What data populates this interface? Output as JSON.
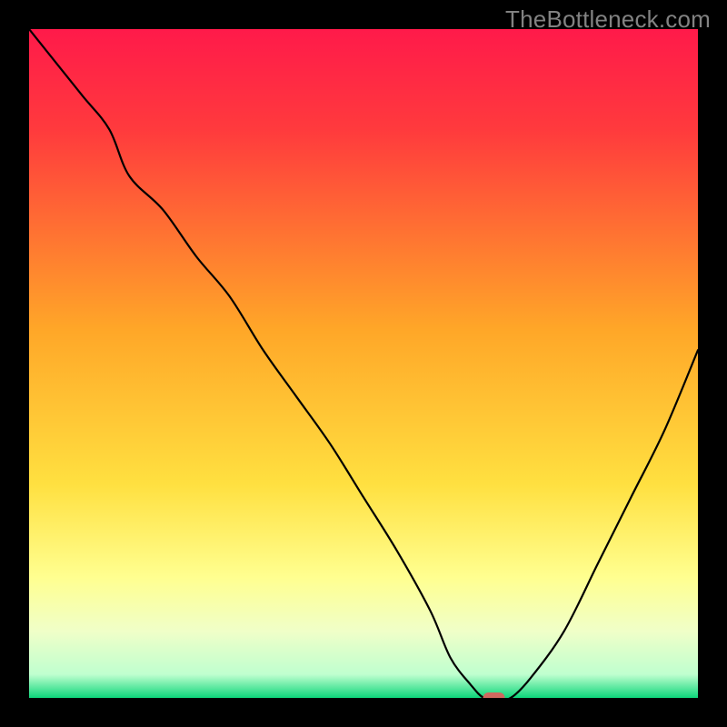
{
  "attribution": "TheBottleneck.com",
  "colors": {
    "gradient_top": "#ff1a4a",
    "gradient_mid": "#ffc300",
    "gradient_lowmid": "#ffff80",
    "gradient_pale": "#f5ffd8",
    "gradient_bottom": "#0dd67a",
    "curve": "#000000",
    "marker": "#cf695f",
    "frame": "#000000"
  },
  "chart_data": {
    "type": "line",
    "title": "",
    "xlabel": "",
    "ylabel": "",
    "xlim": [
      0,
      100
    ],
    "ylim": [
      0,
      100
    ],
    "series": [
      {
        "name": "bottleneck-curve",
        "x": [
          0,
          4,
          8,
          12,
          15,
          20,
          25,
          30,
          35,
          40,
          45,
          50,
          55,
          60,
          63,
          66,
          68,
          70,
          72,
          75,
          80,
          85,
          90,
          95,
          100
        ],
        "values": [
          100,
          95,
          90,
          85,
          78,
          73,
          66,
          60,
          52,
          45,
          38,
          30,
          22,
          13,
          6,
          2,
          0,
          0,
          0,
          3,
          10,
          20,
          30,
          40,
          52
        ]
      }
    ],
    "marker": {
      "x": 69.5,
      "y": 0
    },
    "background_gradient": {
      "orientation": "vertical",
      "stops": [
        {
          "offset": 0.0,
          "color": "#ff1a4a"
        },
        {
          "offset": 0.15,
          "color": "#ff3a3d"
        },
        {
          "offset": 0.45,
          "color": "#ffa728"
        },
        {
          "offset": 0.68,
          "color": "#ffe040"
        },
        {
          "offset": 0.82,
          "color": "#ffff90"
        },
        {
          "offset": 0.9,
          "color": "#f0ffc8"
        },
        {
          "offset": 0.965,
          "color": "#bfffcf"
        },
        {
          "offset": 1.0,
          "color": "#0dd67a"
        }
      ]
    }
  }
}
